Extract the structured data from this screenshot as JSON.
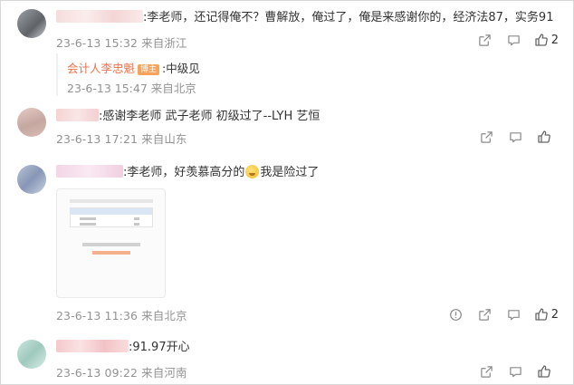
{
  "comments": [
    {
      "text": ":李老师，还记得俺不？曹解放，俺过了，俺是来感谢你的，经济法87，实务91",
      "time": "23-6-13 15:32",
      "source": "来自浙江",
      "like_count": "2",
      "reply": {
        "author": "会计人李忠魁",
        "badge": "博主",
        "text": ":中级见",
        "time": "23-6-13 15:47",
        "source": "来自北京"
      }
    },
    {
      "text": ":感谢李老师 武子老师  初级过了--LYH 艺恒",
      "time": "23-6-13 17:21",
      "source": "来自山东"
    },
    {
      "text_before": ":李老师，好羡慕高分的",
      "text_after": "我是险过了",
      "time": "23-6-13 11:36",
      "source": "来自北京",
      "like_count": "2"
    },
    {
      "text": ":91.97开心",
      "time": "23-6-13 09:22",
      "source": "来自河南"
    }
  ],
  "icons": {
    "share": "share-icon",
    "comment": "comment-icon",
    "like": "thumbs-up-icon",
    "info": "info-icon",
    "emoji": "crying-laughing-emoji-icon"
  },
  "colors": {
    "author_accent": "#eb7350",
    "badge_bg": "#f7a35c",
    "meta_gray": "#939393"
  }
}
